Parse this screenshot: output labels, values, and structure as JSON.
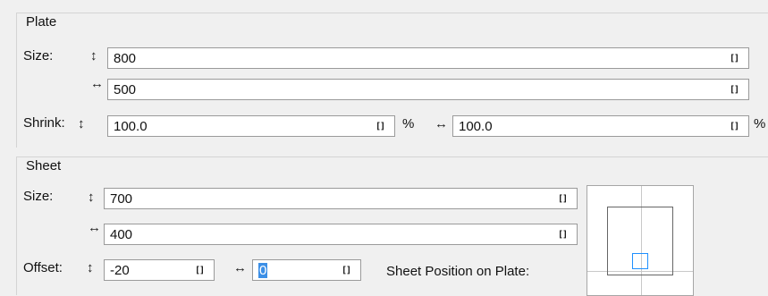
{
  "plate": {
    "title": "Plate",
    "size_label": "Size:",
    "vertical_arrow": "↕",
    "horizontal_arrow": "↔",
    "height_value": "800",
    "width_value": "500",
    "unit_icon": "[]",
    "shrink_label": "Shrink:",
    "shrink_vertical_value": "100.0",
    "shrink_horizontal_value": "100.0",
    "percent": "%"
  },
  "sheet": {
    "title": "Sheet",
    "size_label": "Size:",
    "vertical_arrow": "↕",
    "horizontal_arrow": "↔",
    "height_value": "700",
    "width_value": "400",
    "unit_icon": "[]",
    "offset_label": "Offset:",
    "offset_vertical_value": "-20",
    "offset_horizontal_value": "0",
    "position_label": "Sheet Position on Plate:"
  }
}
